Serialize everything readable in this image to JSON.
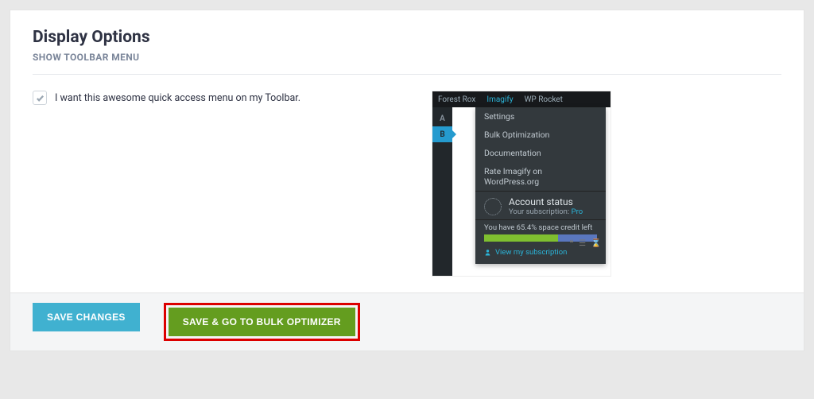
{
  "section": {
    "title": "Display Options",
    "subtitle": "SHOW TOOLBAR MENU"
  },
  "options": {
    "toolbar_checkbox": {
      "label": "I want this awesome quick access menu on my Toolbar.",
      "checked": true
    }
  },
  "preview": {
    "tabs": [
      "Forest Rox",
      "Imagify",
      "WP Rocket"
    ],
    "active_tab": "Imagify",
    "menu_items": [
      "Settings",
      "Bulk Optimization",
      "Documentation",
      "Rate Imagify on WordPress.org"
    ],
    "status": {
      "title": "Account status",
      "subscription_label": "Your subscription:",
      "subscription_tier": "Pro",
      "credit_text": "You have 65.4% space credit left",
      "credit_percent": 65.4,
      "view_link": "View my subscription"
    }
  },
  "buttons": {
    "save": "Save Changes",
    "bulk": "Save & Go to Bulk Optimizer"
  }
}
